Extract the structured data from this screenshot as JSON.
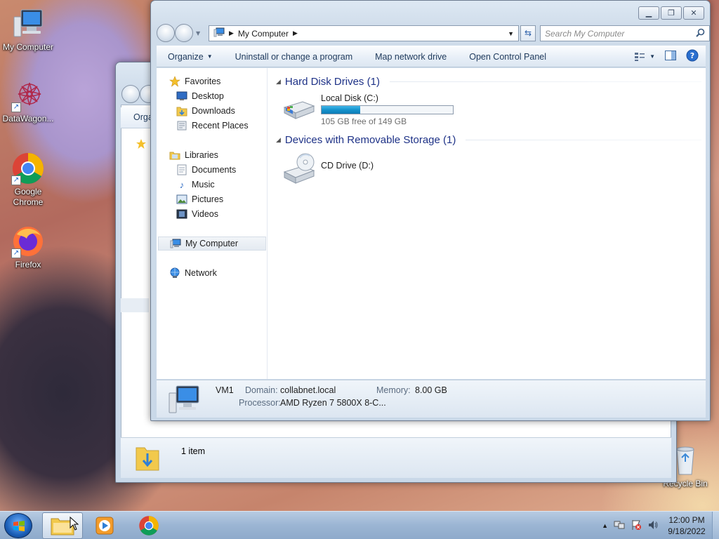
{
  "desktop": {
    "icons": [
      {
        "label": "My Computer"
      },
      {
        "label": "DataWagon..."
      },
      {
        "label": "Google Chrome"
      },
      {
        "label": "Firefox"
      },
      {
        "label": "Recycle Bin"
      }
    ]
  },
  "back_window": {
    "toolbar_partial": "Orga",
    "status_text": "1 item"
  },
  "window": {
    "breadcrumb": [
      "My Computer"
    ],
    "search_placeholder": "Search My Computer",
    "toolbar": {
      "organize": "Organize",
      "uninstall": "Uninstall or change a program",
      "map_drive": "Map network drive",
      "control_panel": "Open Control Panel"
    },
    "nav": {
      "favorites": "Favorites",
      "desktop": "Desktop",
      "downloads": "Downloads",
      "recent": "Recent Places",
      "libraries": "Libraries",
      "documents": "Documents",
      "music": "Music",
      "pictures": "Pictures",
      "videos": "Videos",
      "computer": "My Computer",
      "network": "Network"
    },
    "groups": {
      "hard_disks": "Hard Disk Drives (1)",
      "removable": "Devices with Removable Storage (1)"
    },
    "drives": {
      "c_name": "Local Disk (C:)",
      "c_free": "105 GB free of 149 GB",
      "c_used_fraction": 0.295,
      "d_name": "CD Drive (D:)"
    },
    "details": {
      "name": "VM1",
      "domain_label": "Domain:",
      "domain": "collabnet.local",
      "memory_label": "Memory:",
      "memory": "8.00 GB",
      "processor_label": "Processor:",
      "processor": "AMD Ryzen 7 5800X 8-C..."
    }
  },
  "taskbar": {
    "time": "12:00 PM",
    "date": "9/18/2022"
  },
  "colors": {
    "accent_text": "#1e3287",
    "usage_fill": "#1693cd"
  }
}
